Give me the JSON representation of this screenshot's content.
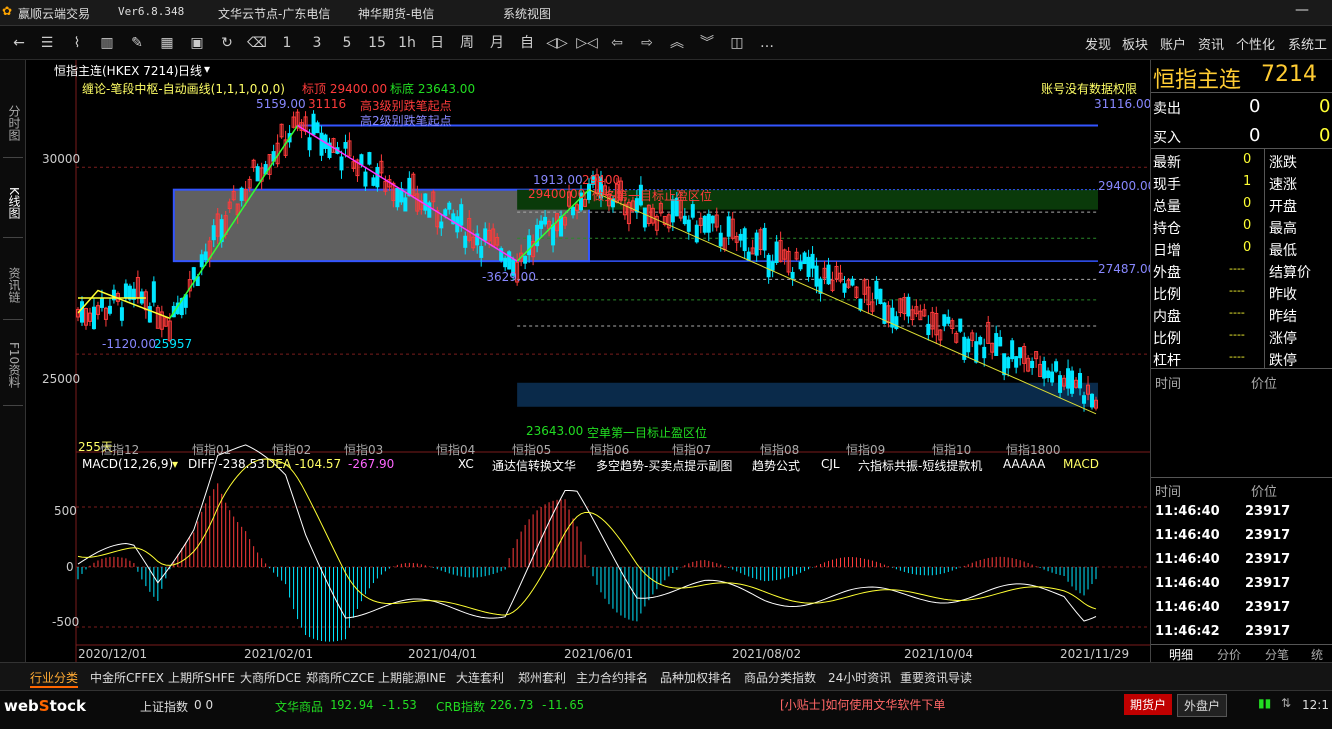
{
  "app": {
    "title": "赢顺云端交易",
    "version": "Ver6.8.348",
    "node1": "文华云节点-广东电信",
    "node2": "神华期货-电信",
    "menu": "系统​​​​视图"
  },
  "toolbar": {
    "nums": [
      "1",
      "3",
      "5",
      "15",
      "1h",
      "日",
      "周",
      "月",
      "自"
    ],
    "right": [
      "发现",
      "板块",
      "账户",
      "资讯",
      "个性化",
      "系统工"
    ]
  },
  "lefttabs": [
    "分时图",
    "K线图",
    "资讯链",
    "F10资料"
  ],
  "header": {
    "instrument": "恒指主连(HKEX 7214)",
    "period": "日线"
  },
  "indicator": {
    "name": "缠论-笔段中枢-自动画线(1,1,1,0,0,0)",
    "target_high_label": "标顶 29400.00",
    "target_low_label": "标底 23643.00",
    "no_permission": "账号没有数据权限"
  },
  "annotations": {
    "a1": "5159.00",
    "a2": "31116",
    "a3": "高3级别跌笔起点",
    "a4": "高2级别跌笔起点",
    "a5": "31116.00",
    "a6": "1913.00",
    "a7": "29400",
    "a8": "29400.00",
    "a9": "做多第一目标止盈区位",
    "a10": "29400.00",
    "a11": "-3629.00",
    "a12": "27487.00",
    "a13": "-1120.00",
    "a14": "25957",
    "a15": "23643.00",
    "a16": "空单第一目标止盈区位",
    "a17": "255天"
  },
  "yticks": [
    "30000",
    "25000"
  ],
  "xmonths": [
    "恒指12",
    "恒指01",
    "恒指02",
    "恒指03",
    "恒指04",
    "恒指05",
    "恒指06",
    "恒指07",
    "恒指08",
    "恒指09",
    "恒指10",
    "恒指1800"
  ],
  "macd": {
    "label": "MACD(12,26,9)",
    "diff": "DIFF -238.53",
    "dea": "DEA -104.57",
    "val": "-267.90",
    "items": [
      "XC",
      "通达信转换文华",
      "多空趋势-买卖点提示副图",
      "趋势公式",
      "CJL",
      "六指标共振-短线提款机",
      "AAAAA",
      "MACD"
    ],
    "yticks": [
      "500",
      "0",
      "-500"
    ]
  },
  "dates": [
    "2020/12/01",
    "2021/02/01",
    "2021/04/01",
    "2021/06/01",
    "2021/08/02",
    "2021/10/04",
    "2021/11/29"
  ],
  "right": {
    "title": "恒指主连",
    "code": "7214",
    "ask_label": "卖出",
    "ask": "0",
    "bid_label": "买入",
    "bid": "0",
    "rows": [
      [
        "最新",
        "0",
        "涨跌",
        ""
      ],
      [
        "现手",
        "1",
        "速涨",
        ""
      ],
      [
        "总量",
        "0",
        "开盘",
        ""
      ],
      [
        "持仓",
        "0",
        "最高",
        ""
      ],
      [
        "日增",
        "0",
        "最低",
        ""
      ],
      [
        "外盘",
        "----",
        "结算价",
        ""
      ],
      [
        "比例",
        "----",
        "昨收",
        ""
      ],
      [
        "内盘",
        "----",
        "昨结",
        ""
      ],
      [
        "比例",
        "----",
        "涨停",
        ""
      ],
      [
        "杠杆",
        "----",
        "跌停",
        ""
      ]
    ],
    "col_time": "时间",
    "col_price": "价位",
    "ticks": [
      [
        "11:46:40",
        "23917"
      ],
      [
        "11:46:40",
        "23917"
      ],
      [
        "11:46:40",
        "23917"
      ],
      [
        "11:46:40",
        "23917"
      ],
      [
        "11:46:40",
        "23917"
      ],
      [
        "11:46:42",
        "23917"
      ]
    ],
    "tabs": [
      "明细",
      "分价",
      "分笔",
      "统"
    ]
  },
  "bottomtabs": [
    "行业分类",
    "中金所CFFEX",
    "上期所SHFE",
    "大商所DCE",
    "郑商所CZCE",
    "上期能源INE",
    "大连套利",
    "郑州套利",
    "主力合约排名",
    "品种加权排名",
    "商品分类指数",
    "24小时资讯",
    "重要资讯导读"
  ],
  "status": {
    "logo": "webstock",
    "idx1_label": "上证指数",
    "idx1": "0 0",
    "idx2_label": "文华商品",
    "idx2": "192.94 -1.53",
    "idx3_label": "CRB指数",
    "idx3": "226.73 -11.65",
    "tip": "[小贴士]如何使用文华软件下单",
    "btn1": "期货户",
    "btn2": "外盘户",
    "time": "12:1"
  },
  "chart_data": {
    "type": "candlestick",
    "price_ylim": [
      22700,
      31800
    ],
    "macd_ylim": [
      -650,
      850
    ],
    "trend_points": [
      [
        0,
        26100
      ],
      [
        17,
        26500
      ],
      [
        23,
        25957
      ],
      [
        45,
        30000
      ],
      [
        55,
        31116
      ],
      [
        110,
        27487
      ],
      [
        128,
        29400
      ],
      [
        160,
        28300
      ],
      [
        200,
        26400
      ],
      [
        250,
        24300
      ],
      [
        255,
        23643
      ]
    ],
    "colors": {
      "up": "#ff3b3b",
      "down": "#00e5ff",
      "bg": "#000000",
      "grid": "#7a1d1d"
    }
  }
}
